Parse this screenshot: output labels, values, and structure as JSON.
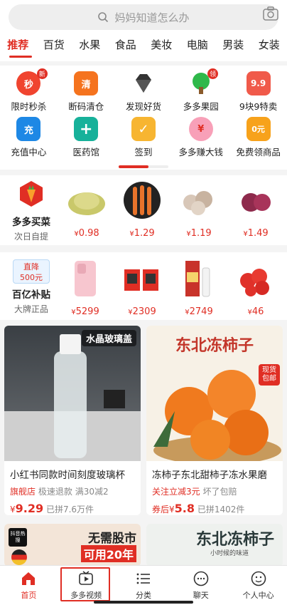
{
  "search": {
    "placeholder": "妈妈知道怎么办"
  },
  "tabs": [
    "推荐",
    "百货",
    "水果",
    "食品",
    "美妆",
    "电脑",
    "男装",
    "女装"
  ],
  "shortcuts": [
    {
      "label": "限时秒杀",
      "badge": "新",
      "color": "#f0442f",
      "glyph": "秒"
    },
    {
      "label": "断码清仓",
      "badge": "",
      "color": "#f5731e",
      "glyph": "清"
    },
    {
      "label": "发现好货",
      "badge": "",
      "color": "#333333",
      "glyph": ""
    },
    {
      "label": "多多果园",
      "badge": "领",
      "color": "#2fb84a",
      "glyph": ""
    },
    {
      "label": "9块9特卖",
      "badge": "",
      "color": "#f05a4a",
      "glyph": "9.9"
    },
    {
      "label": "充值中心",
      "badge": "",
      "color": "#1e88e5",
      "glyph": "充"
    },
    {
      "label": "医药馆",
      "badge": "",
      "color": "#17b19a",
      "glyph": "+"
    },
    {
      "label": "签到",
      "badge": "",
      "color": "#f7b531",
      "glyph": "✓"
    },
    {
      "label": "多多赚大钱",
      "badge": "",
      "color": "#f8a0b8",
      "glyph": "¥"
    },
    {
      "label": "免费领商品",
      "badge": "",
      "color": "#f7a21b",
      "glyph": "0元"
    }
  ],
  "row1": {
    "title": "多多买菜",
    "subtitle": "次日自提",
    "prices": [
      "0.98",
      "1.29",
      "1.19",
      "1.49"
    ],
    "currency": "¥"
  },
  "row2": {
    "badge_top": "直降",
    "badge_bottom": "500元",
    "title": "百亿补贴",
    "subtitle": "大牌正品",
    "prices": [
      "5299",
      "2309",
      "2749",
      "46"
    ],
    "currency": "¥"
  },
  "cards": [
    {
      "overlay": "水晶玻璃盖",
      "title": "小红书同款时间刻度玻璃杯",
      "tag": "旗舰店",
      "meta1": "极速退款",
      "meta2": "满30减2",
      "price_prefix": "¥",
      "price": "9.29",
      "sold": "已拼7.6万件"
    },
    {
      "overlay": "东北冻柿子",
      "sticker": "现货包邮",
      "title": "冻柿子东北甜柿子冻水果磨",
      "tag": "关注立减3元",
      "meta1": "坏了包赔",
      "meta2": "",
      "price_prefix": "券后¥",
      "price": "5.8",
      "sold": "已拼1402件"
    }
  ],
  "cards_next": [
    {
      "logo": "抖音热搜",
      "line1": "无需股市",
      "line2": "可用20年"
    },
    {
      "headline": "东北冻柿子",
      "note": "小时候的味道"
    }
  ],
  "nav": [
    {
      "label": "首页",
      "icon": "home-icon"
    },
    {
      "label": "多多视频",
      "icon": "video-icon"
    },
    {
      "label": "分类",
      "icon": "category-icon"
    },
    {
      "label": "聊天",
      "icon": "chat-icon"
    },
    {
      "label": "个人中心",
      "icon": "profile-icon"
    }
  ],
  "colors": {
    "accent": "#e02e24"
  }
}
